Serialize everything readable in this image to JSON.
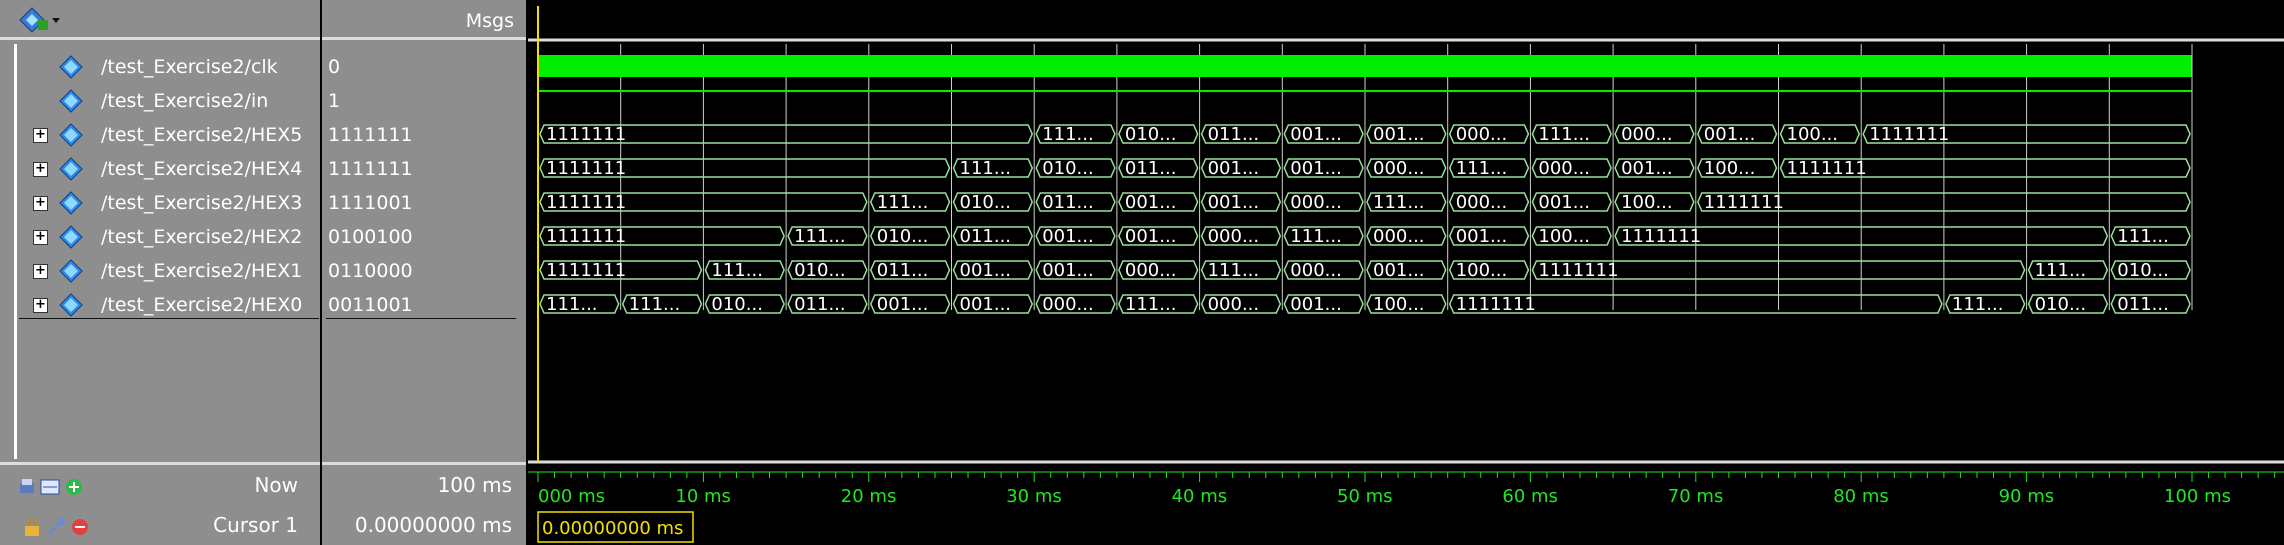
{
  "names_header": {
    "icon": "wave-toolbox-icon"
  },
  "values_header": {
    "label": "Msgs"
  },
  "signals": [
    {
      "name": "/test_Exercise2/clk",
      "value": "0",
      "type": "bit"
    },
    {
      "name": "/test_Exercise2/in",
      "value": "1",
      "type": "bit"
    },
    {
      "name": "/test_Exercise2/HEX5",
      "value": "1111111",
      "type": "bus",
      "segments": [
        {
          "from": 0,
          "to": 30,
          "label": "1111111"
        },
        {
          "from": 30,
          "to": 35,
          "label": "111..."
        },
        {
          "from": 35,
          "to": 40,
          "label": "010..."
        },
        {
          "from": 40,
          "to": 45,
          "label": "011..."
        },
        {
          "from": 45,
          "to": 50,
          "label": "001..."
        },
        {
          "from": 50,
          "to": 55,
          "label": "001..."
        },
        {
          "from": 55,
          "to": 60,
          "label": "000..."
        },
        {
          "from": 60,
          "to": 65,
          "label": "111..."
        },
        {
          "from": 65,
          "to": 70,
          "label": "000..."
        },
        {
          "from": 70,
          "to": 75,
          "label": "001..."
        },
        {
          "from": 75,
          "to": 80,
          "label": "100..."
        },
        {
          "from": 80,
          "to": 100,
          "label": "1111111"
        }
      ]
    },
    {
      "name": "/test_Exercise2/HEX4",
      "value": "1111111",
      "type": "bus",
      "segments": [
        {
          "from": 0,
          "to": 25,
          "label": "1111111"
        },
        {
          "from": 25,
          "to": 30,
          "label": "111..."
        },
        {
          "from": 30,
          "to": 35,
          "label": "010..."
        },
        {
          "from": 35,
          "to": 40,
          "label": "011..."
        },
        {
          "from": 40,
          "to": 45,
          "label": "001..."
        },
        {
          "from": 45,
          "to": 50,
          "label": "001..."
        },
        {
          "from": 50,
          "to": 55,
          "label": "000..."
        },
        {
          "from": 55,
          "to": 60,
          "label": "111..."
        },
        {
          "from": 60,
          "to": 65,
          "label": "000..."
        },
        {
          "from": 65,
          "to": 70,
          "label": "001..."
        },
        {
          "from": 70,
          "to": 75,
          "label": "100..."
        },
        {
          "from": 75,
          "to": 100,
          "label": "1111111"
        }
      ]
    },
    {
      "name": "/test_Exercise2/HEX3",
      "value": "1111001",
      "type": "bus",
      "segments": [
        {
          "from": 0,
          "to": 20,
          "label": "1111111"
        },
        {
          "from": 20,
          "to": 25,
          "label": "111..."
        },
        {
          "from": 25,
          "to": 30,
          "label": "010..."
        },
        {
          "from": 30,
          "to": 35,
          "label": "011..."
        },
        {
          "from": 35,
          "to": 40,
          "label": "001..."
        },
        {
          "from": 40,
          "to": 45,
          "label": "001..."
        },
        {
          "from": 45,
          "to": 50,
          "label": "000..."
        },
        {
          "from": 50,
          "to": 55,
          "label": "111..."
        },
        {
          "from": 55,
          "to": 60,
          "label": "000..."
        },
        {
          "from": 60,
          "to": 65,
          "label": "001..."
        },
        {
          "from": 65,
          "to": 70,
          "label": "100..."
        },
        {
          "from": 70,
          "to": 100,
          "label": "1111111"
        }
      ]
    },
    {
      "name": "/test_Exercise2/HEX2",
      "value": "0100100",
      "type": "bus",
      "segments": [
        {
          "from": 0,
          "to": 15,
          "label": "1111111"
        },
        {
          "from": 15,
          "to": 20,
          "label": "111..."
        },
        {
          "from": 20,
          "to": 25,
          "label": "010..."
        },
        {
          "from": 25,
          "to": 30,
          "label": "011..."
        },
        {
          "from": 30,
          "to": 35,
          "label": "001..."
        },
        {
          "from": 35,
          "to": 40,
          "label": "001..."
        },
        {
          "from": 40,
          "to": 45,
          "label": "000..."
        },
        {
          "from": 45,
          "to": 50,
          "label": "111..."
        },
        {
          "from": 50,
          "to": 55,
          "label": "000..."
        },
        {
          "from": 55,
          "to": 60,
          "label": "001..."
        },
        {
          "from": 60,
          "to": 65,
          "label": "100..."
        },
        {
          "from": 65,
          "to": 95,
          "label": "1111111"
        },
        {
          "from": 95,
          "to": 100,
          "label": "111..."
        }
      ]
    },
    {
      "name": "/test_Exercise2/HEX1",
      "value": "0110000",
      "type": "bus",
      "segments": [
        {
          "from": 0,
          "to": 10,
          "label": "1111111"
        },
        {
          "from": 10,
          "to": 15,
          "label": "111..."
        },
        {
          "from": 15,
          "to": 20,
          "label": "010..."
        },
        {
          "from": 20,
          "to": 25,
          "label": "011..."
        },
        {
          "from": 25,
          "to": 30,
          "label": "001..."
        },
        {
          "from": 30,
          "to": 35,
          "label": "001..."
        },
        {
          "from": 35,
          "to": 40,
          "label": "000..."
        },
        {
          "from": 40,
          "to": 45,
          "label": "111..."
        },
        {
          "from": 45,
          "to": 50,
          "label": "000..."
        },
        {
          "from": 50,
          "to": 55,
          "label": "001..."
        },
        {
          "from": 55,
          "to": 60,
          "label": "100..."
        },
        {
          "from": 60,
          "to": 90,
          "label": "1111111"
        },
        {
          "from": 90,
          "to": 95,
          "label": "111..."
        },
        {
          "from": 95,
          "to": 100,
          "label": "010..."
        }
      ]
    },
    {
      "name": "/test_Exercise2/HEX0",
      "value": "0011001",
      "type": "bus",
      "segments": [
        {
          "from": 0,
          "to": 5,
          "label": "111..."
        },
        {
          "from": 5,
          "to": 10,
          "label": "111..."
        },
        {
          "from": 10,
          "to": 15,
          "label": "010..."
        },
        {
          "from": 15,
          "to": 20,
          "label": "011..."
        },
        {
          "from": 20,
          "to": 25,
          "label": "001..."
        },
        {
          "from": 25,
          "to": 30,
          "label": "001..."
        },
        {
          "from": 30,
          "to": 35,
          "label": "000..."
        },
        {
          "from": 35,
          "to": 40,
          "label": "111..."
        },
        {
          "from": 40,
          "to": 45,
          "label": "000..."
        },
        {
          "from": 45,
          "to": 50,
          "label": "001..."
        },
        {
          "from": 50,
          "to": 55,
          "label": "100..."
        },
        {
          "from": 55,
          "to": 85,
          "label": "1111111"
        },
        {
          "from": 85,
          "to": 90,
          "label": "111..."
        },
        {
          "from": 90,
          "to": 95,
          "label": "010..."
        },
        {
          "from": 95,
          "to": 100,
          "label": "011..."
        }
      ]
    }
  ],
  "footer": {
    "now_label": "Now",
    "now_value": "100 ms",
    "cursor_label": "Cursor 1",
    "cursor_value": "0.00000000 ms",
    "cursor_box": "0.00000000 ms"
  },
  "timeline": {
    "start": 0,
    "end": 100,
    "unit": "ms",
    "major_ticks": [
      0,
      10,
      20,
      30,
      40,
      50,
      60,
      70,
      80,
      90,
      100
    ],
    "tick_labels": [
      "000 ms",
      "10 ms",
      "20 ms",
      "30 ms",
      "40 ms",
      "50 ms",
      "60 ms",
      "70 ms",
      "80 ms",
      "90 ms",
      "100 ms"
    ],
    "grid_step": 5
  },
  "colors": {
    "clk": "#00ee00",
    "bus": "#9be09b",
    "grid": "#d0d0d0",
    "cursor": "#f0e000",
    "ticks": "#1ee81e"
  }
}
